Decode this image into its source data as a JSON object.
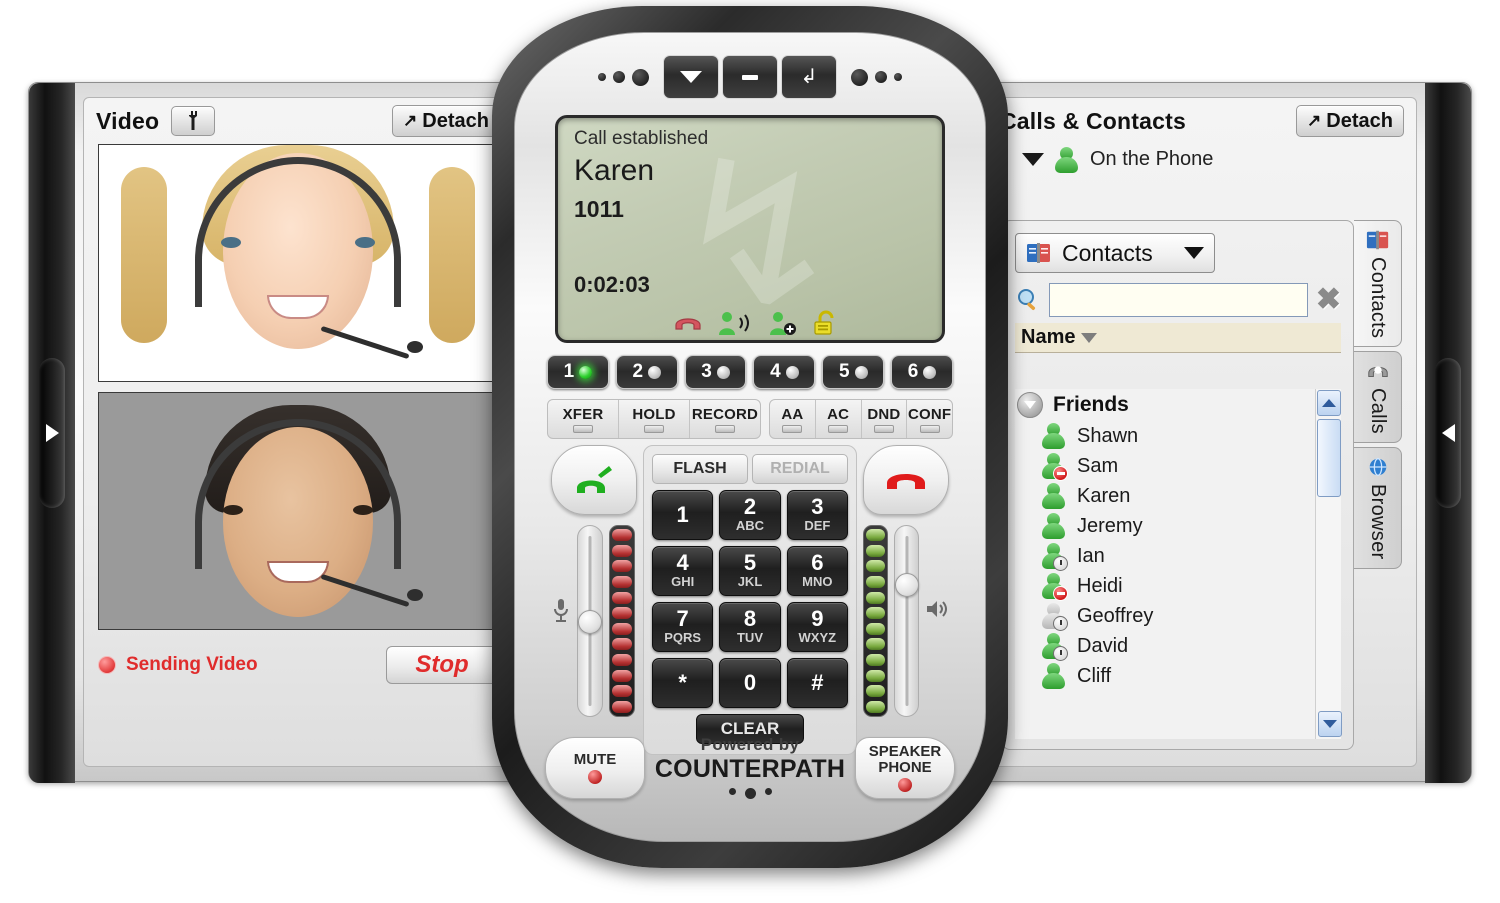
{
  "video_panel": {
    "title": "Video",
    "settings_icon": "wrench-icon",
    "detach_label": "Detach",
    "detach_glyph": "↗",
    "status_text": "Sending Video",
    "status_icon": "record-dot-icon",
    "stop_label": "Stop",
    "collapse_glyph": "▶"
  },
  "titlebar": {
    "menu_glyph": "▼",
    "minimize_glyph": "—",
    "tray_glyph": "↲",
    "menu_name": "menu-button",
    "minimize_name": "minimize-button",
    "tray_name": "minimize-to-tray-button"
  },
  "lcd": {
    "status": "Call established",
    "caller_name": "Karen",
    "caller_number": "1011",
    "duration": "0:02:03",
    "ghost_glyph": "↳",
    "icons": [
      {
        "name": "hangup-icon",
        "glyph": "☎",
        "color": "#d4555f"
      },
      {
        "name": "speaking-icon",
        "glyph": "὆4",
        "color": "#3aa93a"
      },
      {
        "name": "add-contact-icon",
        "glyph": "὆4",
        "color": "#3aa93a"
      },
      {
        "name": "unlocked-icon",
        "glyph": "ὑ3",
        "color": "#d8cf28"
      }
    ]
  },
  "lines": [
    {
      "label": "1",
      "active": true
    },
    {
      "label": "2",
      "active": false
    },
    {
      "label": "3",
      "active": false
    },
    {
      "label": "4",
      "active": false
    },
    {
      "label": "5",
      "active": false
    },
    {
      "label": "6",
      "active": false
    }
  ],
  "features_group_1": [
    {
      "label": "XFER"
    },
    {
      "label": "HOLD"
    },
    {
      "label": "RECORD"
    }
  ],
  "features_group_2": [
    {
      "label": "AA"
    },
    {
      "label": "AC"
    },
    {
      "label": "DND"
    },
    {
      "label": "CONF"
    }
  ],
  "keypad": {
    "flash_label": "FLASH",
    "redial_label": "REDIAL",
    "clear_label": "CLEAR",
    "keys": [
      {
        "digit": "1",
        "letters": ""
      },
      {
        "digit": "2",
        "letters": "ABC"
      },
      {
        "digit": "3",
        "letters": "DEF"
      },
      {
        "digit": "4",
        "letters": "GHI"
      },
      {
        "digit": "5",
        "letters": "JKL"
      },
      {
        "digit": "6",
        "letters": "MNO"
      },
      {
        "digit": "7",
        "letters": "PQRS"
      },
      {
        "digit": "8",
        "letters": "TUV"
      },
      {
        "digit": "9",
        "letters": "WXYZ"
      },
      {
        "digit": "*",
        "letters": ""
      },
      {
        "digit": "0",
        "letters": ""
      },
      {
        "digit": "#",
        "letters": ""
      }
    ]
  },
  "call_controls": {
    "answer_glyph": "☎",
    "hangup_glyph": "☎",
    "mute_label": "MUTE",
    "speaker_label_1": "SPEAKER",
    "speaker_label_2": "PHONE",
    "mic_icon": "microphone-icon",
    "speaker_icon": "speaker-icon",
    "mic_icon_glyph": "Ἲ4",
    "speaker_icon_glyph": "ὐA",
    "mic_volume_percent": 50,
    "speaker_volume_percent": 72,
    "mic_meter_segments": 12,
    "speaker_meter_segments": 12
  },
  "branding": {
    "line1": "Powered by",
    "line2": "COUNTERPATH"
  },
  "contacts_panel": {
    "title": "Calls & Contacts",
    "detach_label": "Detach",
    "detach_glyph": "↗",
    "collapse_glyph": "◀",
    "presence_status": "On the Phone",
    "presence_icon": "on-the-phone-icon",
    "source_label": "Contacts",
    "source_icon": "address-book-icon",
    "search_value": "",
    "search_placeholder": "",
    "search_icon": "magnifier-icon",
    "clear_search_glyph": "✖",
    "column_header": "Name",
    "group": {
      "name": "Friends",
      "expanded": true
    },
    "contacts": [
      {
        "name": "Shawn",
        "presence": "available"
      },
      {
        "name": "Sam",
        "presence": "busy"
      },
      {
        "name": "Karen",
        "presence": "onphone"
      },
      {
        "name": "Jeremy",
        "presence": "available"
      },
      {
        "name": "Ian",
        "presence": "away"
      },
      {
        "name": "Heidi",
        "presence": "busy"
      },
      {
        "name": "Geoffrey",
        "presence": "offline"
      },
      {
        "name": "David",
        "presence": "away"
      },
      {
        "name": "Cliff",
        "presence": "available"
      }
    ],
    "tabs": [
      {
        "label": "Contacts",
        "icon": "address-book-icon",
        "glyph": "Ὅ6",
        "active": true
      },
      {
        "label": "Calls",
        "icon": "calls-icon",
        "glyph": "☎",
        "active": false
      },
      {
        "label": "Browser",
        "icon": "browser-icon",
        "glyph": "ἱ0",
        "active": false
      }
    ],
    "scroll_up_glyph": "▲",
    "scroll_down_glyph": "▼"
  },
  "colors": {
    "accent_green": "#2f9e2f",
    "accent_red": "#e02c2c",
    "lcd_bg": "#c3ccb4",
    "chrome": "#e3e3e3"
  }
}
